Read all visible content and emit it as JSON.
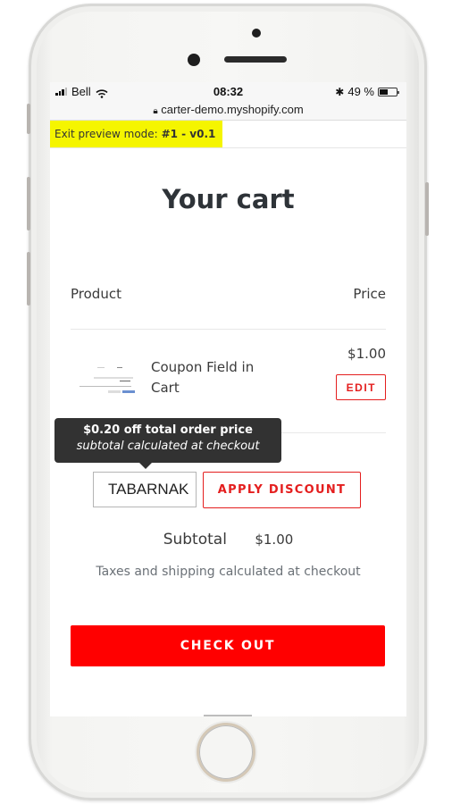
{
  "status_bar": {
    "carrier": "Bell",
    "time": "08:32",
    "battery_text": "49 %",
    "battery_level": 0.49
  },
  "url_bar": {
    "url": "carter-demo.myshopify.com"
  },
  "preview_bar": {
    "label": "Exit preview mode:",
    "version": "#1 - v0.1"
  },
  "cart": {
    "title": "Your cart",
    "columns": {
      "product": "Product",
      "price": "Price"
    },
    "items": [
      {
        "name": "Coupon Field in Cart",
        "price": "$1.00",
        "edit_label": "EDIT"
      }
    ],
    "tooltip": {
      "line1": "$0.20 off total order price",
      "line2": "subtotal calculated at checkout"
    },
    "coupon_value": "TABARNAK",
    "apply_label": "APPLY DISCOUNT",
    "subtotal_label": "Subtotal",
    "subtotal_value": "$1.00",
    "taxes_note": "Taxes and shipping calculated at checkout",
    "checkout_label": "CHECK OUT"
  },
  "colors": {
    "accent": "#ff0000",
    "preview_highlight": "#f5f500",
    "tooltip_bg": "#323232"
  }
}
